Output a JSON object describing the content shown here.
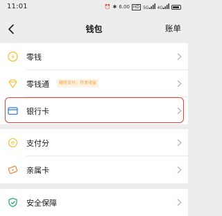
{
  "status_bar": {
    "time": "11:01",
    "icons": [
      "alarm-icon",
      "bluetooth-icon",
      "network-speed-icon",
      "hd-icon",
      "signal-icon",
      "signal-icon",
      "battery-icon"
    ],
    "network_speed": "6.00",
    "hd_label": "HD",
    "signal_label_1": "5G",
    "signal_label_2": "4G"
  },
  "nav": {
    "title": "钱包",
    "bill": "账单"
  },
  "group1": [
    {
      "label": "零钱",
      "icon": "coin-icon",
      "color": "#f5c242"
    },
    {
      "label": "零钱通",
      "icon": "diamond-icon",
      "color": "#f5c242",
      "tag": "随时支付，开享收益"
    },
    {
      "label": "银行卡",
      "icon": "card-icon",
      "color": "#2f7de1"
    }
  ],
  "group2": [
    {
      "label": "支付分",
      "icon": "score-icon",
      "color": "#f5c242"
    },
    {
      "label": "亲属卡",
      "icon": "family-card-icon",
      "color": "#f08a3a"
    }
  ],
  "group3": [
    {
      "label": "安全保障",
      "icon": "shield-icon",
      "color": "#2fa86a"
    }
  ],
  "colors": {
    "background": "#ededed",
    "highlight": "#e0433a",
    "chevron": "#b2b2b2"
  }
}
